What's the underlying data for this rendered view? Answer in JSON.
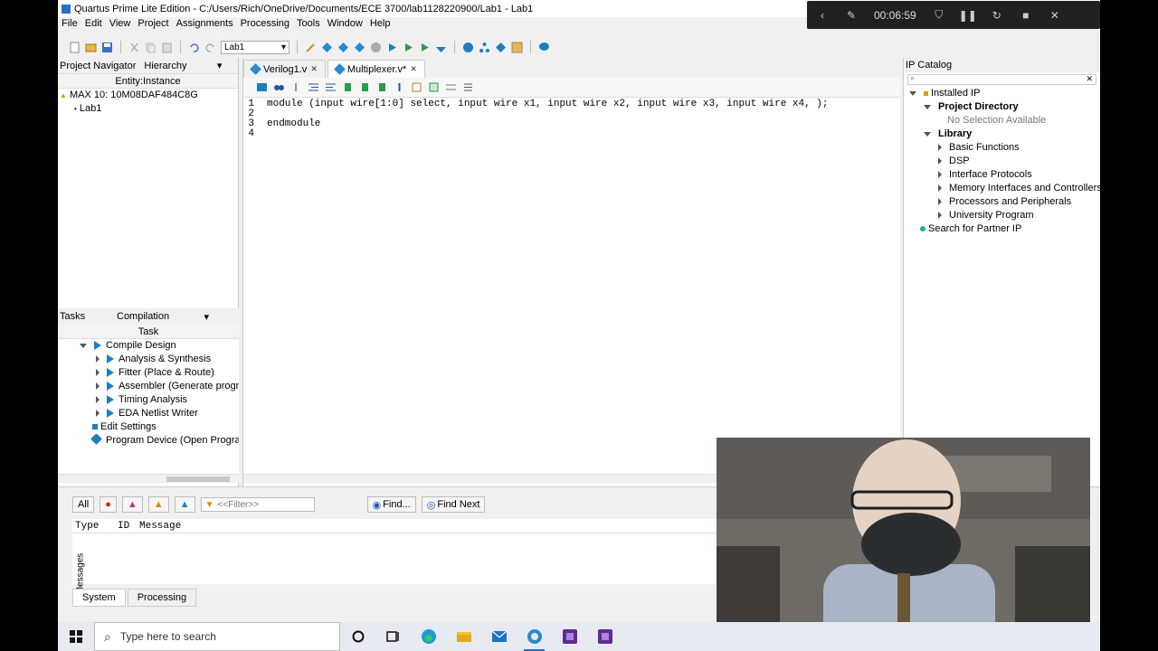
{
  "window": {
    "title": "Quartus Prime Lite Edition - C:/Users/Rich/OneDrive/Documents/ECE 3700/lab1128220900/Lab1 - Lab1"
  },
  "menu": [
    "File",
    "Edit",
    "View",
    "Project",
    "Assignments",
    "Processing",
    "Tools",
    "Window",
    "Help"
  ],
  "toolbar": {
    "revision": "Lab1"
  },
  "project_navigator": {
    "title": "Project Navigator",
    "view": "Hierarchy",
    "column": "Entity:Instance",
    "device": "MAX 10: 10M08DAF484C8G",
    "top_entity": "Lab1"
  },
  "tasks": {
    "title": "Tasks",
    "flow": "Compilation",
    "column": "Task",
    "items": [
      {
        "label": "Compile Design"
      },
      {
        "label": "Analysis & Synthesis"
      },
      {
        "label": "Fitter (Place & Route)"
      },
      {
        "label": "Assembler (Generate program"
      },
      {
        "label": "Timing Analysis"
      },
      {
        "label": "EDA Netlist Writer"
      },
      {
        "label": "Edit Settings"
      },
      {
        "label": "Program Device (Open Programm"
      }
    ]
  },
  "editor": {
    "tabs": [
      {
        "label": "Verilog1.v"
      },
      {
        "label": "Multiplexer.v*"
      }
    ],
    "lines": [
      {
        "no": "1",
        "text": "module (input wire[1:0] select, input wire x1, input wire x2, input wire x3, input wire x4, );"
      },
      {
        "no": "2",
        "text": ""
      },
      {
        "no": "3",
        "text": "endmodule"
      },
      {
        "no": "4",
        "text": ""
      }
    ]
  },
  "ip_catalog": {
    "title": "IP Catalog",
    "installed": "Installed IP",
    "project_directory": "Project Directory",
    "no_selection": "No Selection Available",
    "library": "Library",
    "library_items": [
      "Basic Functions",
      "DSP",
      "Interface Protocols",
      "Memory Interfaces and Controllers",
      "Processors and Peripherals",
      "University Program"
    ],
    "partner": "Search for Partner IP"
  },
  "messages": {
    "all": "All",
    "filter_placeholder": "<<Filter>>",
    "find": "Find...",
    "find_next": "Find Next",
    "columns": [
      "Type",
      "ID",
      "Message"
    ],
    "side_label": "Messages",
    "tabs": [
      "System",
      "Processing"
    ]
  },
  "recorder": {
    "time": "00:06:59"
  },
  "taskbar": {
    "search_placeholder": "Type here to search"
  },
  "colors": {
    "accent": "#1c7fc4",
    "recorder_bg": "#202020",
    "taskbar_bg": "#e7eaf0"
  }
}
